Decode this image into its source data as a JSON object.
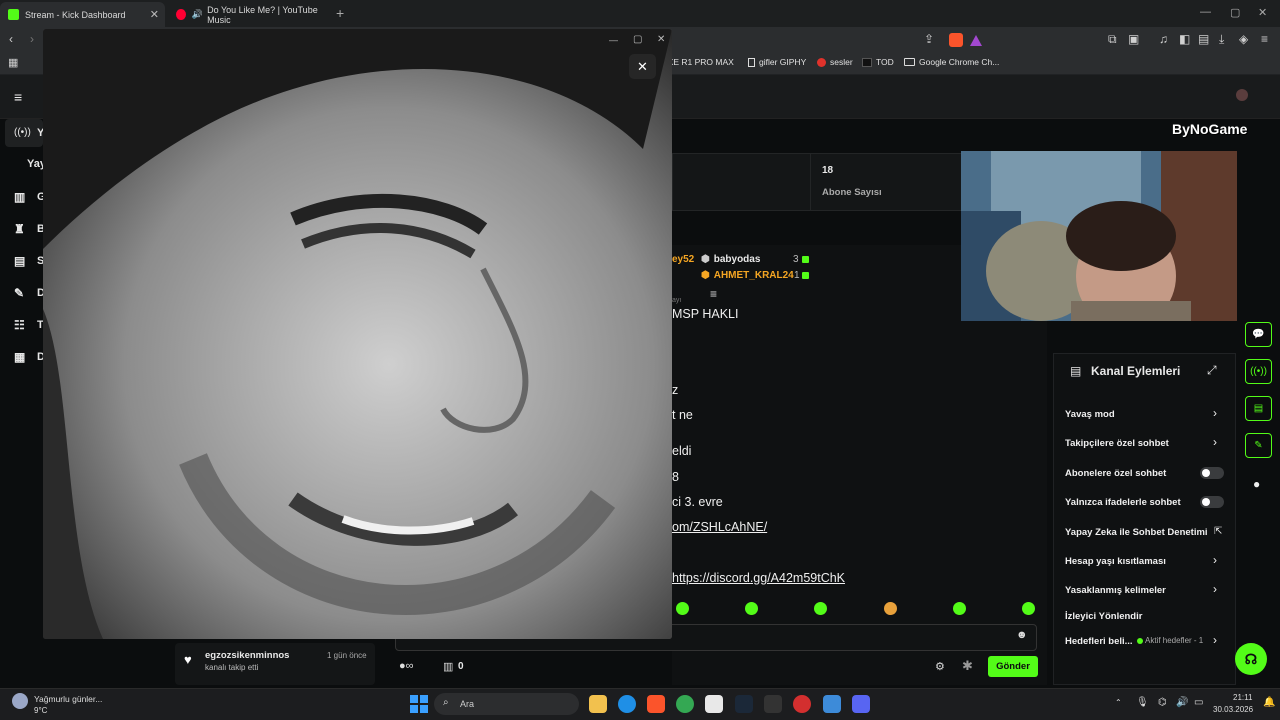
{
  "browser": {
    "tabs": [
      {
        "title": "Stream - Kick Dashboard",
        "color": "#53fc18"
      },
      {
        "title": "Do You Like Me? | YouTube Music",
        "color": "#ff0033"
      }
    ],
    "new_tab": "+",
    "bookmarks": [
      "VXE R1 PRO MAX",
      "gifler GIPHY",
      "sesler",
      "TOD",
      "Google Chrome Ch..."
    ]
  },
  "sidebar": {
    "items": [
      {
        "label": "Y",
        "icon": "broadcast-icon"
      },
      {
        "label": "Yay",
        "icon": ""
      },
      {
        "label": "G",
        "icon": "chart-icon"
      },
      {
        "label": "B",
        "icon": "trophy-icon"
      },
      {
        "label": "S",
        "icon": "layout-icon"
      },
      {
        "label": "D",
        "icon": "wrench-icon"
      },
      {
        "label": "T",
        "icon": "users-icon"
      },
      {
        "label": "D",
        "icon": "stream-icon"
      }
    ]
  },
  "stats": {
    "subscriber_count": "18",
    "subscriber_label": "Abone Sayısı"
  },
  "gifters": {
    "left_name": "ey52",
    "rows": [
      {
        "name": "babyodas",
        "count": "3"
      },
      {
        "name": "AHMET_KRAL24",
        "count": "1"
      }
    ]
  },
  "chat": {
    "lines": [
      {
        "text": "MSP HAKLI",
        "link": false
      },
      {
        "text": "z",
        "link": false
      },
      {
        "text": "t ne",
        "link": false
      },
      {
        "text": "eldi",
        "link": false
      },
      {
        "text": "8",
        "link": false
      },
      {
        "text": "ci 3. evre",
        "link": false
      },
      {
        "text": "om/ZSHLcAhNE/",
        "link": true
      },
      {
        "text": "https://discord.gg/A42m59tChK",
        "link": true
      }
    ],
    "tiny_label": "ayı",
    "points": "0",
    "send_label": "Gönder"
  },
  "follow": {
    "name": "egzozsikenminnos",
    "time": "1 gün önce",
    "action": "kanalı takip etti"
  },
  "channel_actions": {
    "title": "Kanal Eylemleri",
    "items": [
      {
        "label": "Yavaş mod",
        "control": "chevron"
      },
      {
        "label": "Takipçilere özel sohbet",
        "control": "chevron"
      },
      {
        "label": "Abonelere özel sohbet",
        "control": "toggle"
      },
      {
        "label": "Yalnızca ifadelerle sohbet",
        "control": "toggle"
      },
      {
        "label": "Yapay Zeka ile Sohbet Denetimi",
        "control": "external"
      },
      {
        "label": "Hesap yaşı kısıtlaması",
        "control": "chevron"
      },
      {
        "label": "Yasaklanmış kelimeler",
        "control": "chevron"
      },
      {
        "label": "İzleyici Yönlendir",
        "control": "none"
      },
      {
        "label": "Hedefleri beli...",
        "control": "chevron"
      }
    ],
    "active_goals": "Aktif hedefler - 1"
  },
  "overlay": {
    "brand": "ByNoGame"
  },
  "taskbar": {
    "weather_label": "Yağmurlu günler...",
    "weather_temp": "9°C",
    "search_placeholder": "Ara",
    "time": "21:11",
    "date": "30.03.2026"
  },
  "colors": {
    "accent": "#53fc18",
    "bg": "#0b0d0e",
    "panel": "#141617"
  }
}
